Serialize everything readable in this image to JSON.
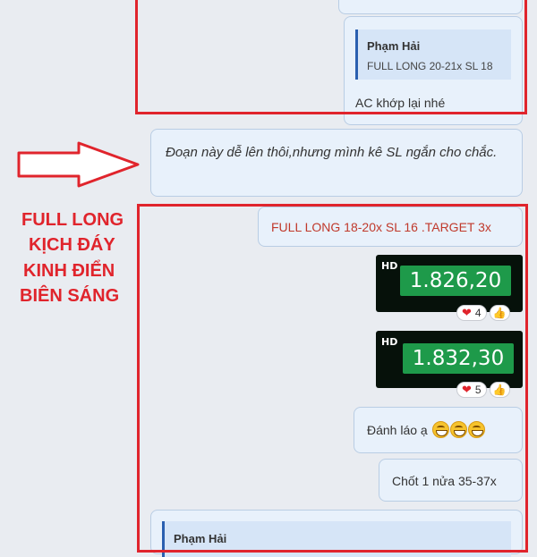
{
  "top_reply": {
    "quote_author": "Phạm Hải",
    "quote_text": "FULL LONG 20-21x SL 18",
    "message": "AC khớp lại nhé"
  },
  "comment": "Đoạn này dễ lên thôi,nhưng mình kê SL ngắn cho chắc.",
  "annotation": {
    "line1": "FULL LONG",
    "line2": "KỊCH ĐÁY",
    "line3": "KINH ĐIỂN",
    "line4": "BIÊN SÁNG"
  },
  "messages": {
    "signal": "FULL LONG 18-20x SL 16 .TARGET 3x",
    "image1": {
      "badge": "HD",
      "price": "1.826,20",
      "hearts": "4"
    },
    "image2": {
      "badge": "HD",
      "price": "1.832,30",
      "hearts": "5"
    },
    "laugh": "Đánh láo ạ",
    "close": "Chốt 1 nửa 35-37x",
    "bottom_quote_author": "Phạm Hải"
  },
  "colors": {
    "annotation_red": "#e0242c",
    "bubble_bg": "#e8f1fb",
    "price_green": "#1e9a4a"
  }
}
